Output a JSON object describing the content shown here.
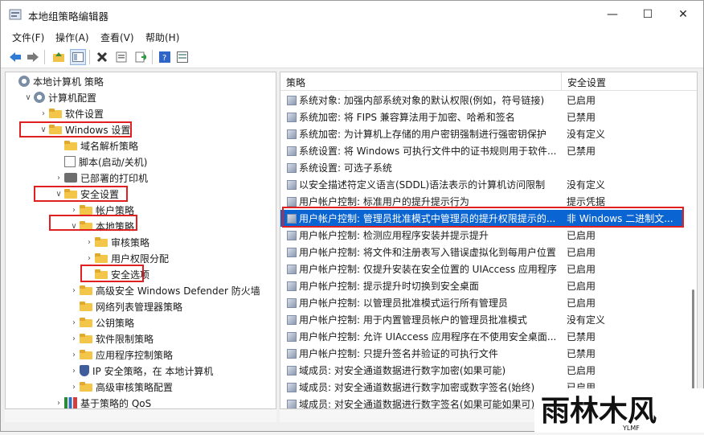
{
  "window": {
    "title": "本地组策略编辑器",
    "minimize": "—",
    "maximize": "☐",
    "close": "✕"
  },
  "menu": [
    "文件(F)",
    "操作(A)",
    "查看(V)",
    "帮助(H)"
  ],
  "toolbar": [
    "back-icon",
    "forward-icon",
    "up-folder-icon",
    "show-tree-icon",
    "delete-icon",
    "properties-icon",
    "export-icon",
    "help-icon",
    "view-icon"
  ],
  "tree": [
    {
      "label": "本地计算机 策略",
      "indent": 0,
      "chev": "",
      "icon": "gear"
    },
    {
      "label": "计算机配置",
      "indent": 1,
      "chev": "∨",
      "icon": "pc"
    },
    {
      "label": "软件设置",
      "indent": 2,
      "chev": "›",
      "icon": "folder"
    },
    {
      "label": "Windows 设置",
      "indent": 2,
      "chev": "∨",
      "icon": "folder"
    },
    {
      "label": "域名解析策略",
      "indent": 3,
      "chev": "",
      "icon": "folder"
    },
    {
      "label": "脚本(启动/关机)",
      "indent": 3,
      "chev": "",
      "icon": "script"
    },
    {
      "label": "已部署的打印机",
      "indent": 3,
      "chev": "›",
      "icon": "printer"
    },
    {
      "label": "安全设置",
      "indent": 3,
      "chev": "∨",
      "icon": "lockfolder"
    },
    {
      "label": "帐户策略",
      "indent": 4,
      "chev": "›",
      "icon": "folder"
    },
    {
      "label": "本地策略",
      "indent": 4,
      "chev": "∨",
      "icon": "folder"
    },
    {
      "label": "审核策略",
      "indent": 5,
      "chev": "›",
      "icon": "folder"
    },
    {
      "label": "用户权限分配",
      "indent": 5,
      "chev": "›",
      "icon": "folder"
    },
    {
      "label": "安全选项",
      "indent": 5,
      "chev": "",
      "icon": "folder"
    },
    {
      "label": "高级安全 Windows Defender 防火墙",
      "indent": 4,
      "chev": "›",
      "icon": "folder"
    },
    {
      "label": "网络列表管理器策略",
      "indent": 4,
      "chev": "",
      "icon": "folder"
    },
    {
      "label": "公钥策略",
      "indent": 4,
      "chev": "›",
      "icon": "folder"
    },
    {
      "label": "软件限制策略",
      "indent": 4,
      "chev": "›",
      "icon": "folder"
    },
    {
      "label": "应用程序控制策略",
      "indent": 4,
      "chev": "›",
      "icon": "folder"
    },
    {
      "label": "IP 安全策略，在 本地计算机",
      "indent": 4,
      "chev": "›",
      "icon": "shield"
    },
    {
      "label": "高级审核策略配置",
      "indent": 4,
      "chev": "›",
      "icon": "folder"
    },
    {
      "label": "基于策略的 QoS",
      "indent": 3,
      "chev": "›",
      "icon": "chart"
    }
  ],
  "list": {
    "headers": [
      "策略",
      "安全设置"
    ],
    "rows": [
      {
        "policy": "系统对象: 加强内部系统对象的默认权限(例如，符号链接)",
        "setting": "已启用"
      },
      {
        "policy": "系统加密: 将 FIPS 兼容算法用于加密、哈希和签名",
        "setting": "已禁用"
      },
      {
        "policy": "系统加密: 为计算机上存储的用户密钥强制进行强密钥保护",
        "setting": "没有定义"
      },
      {
        "policy": "系统设置: 将 Windows 可执行文件中的证书规则用于软件...",
        "setting": "已禁用"
      },
      {
        "policy": "系统设置: 可选子系统",
        "setting": ""
      },
      {
        "policy": "以安全描述符定义语言(SDDL)语法表示的计算机访问限制",
        "setting": "没有定义"
      },
      {
        "policy": "用户帐户控制: 标准用户的提升提示行为",
        "setting": "提示凭据"
      },
      {
        "policy": "用户帐户控制: 管理员批准模式中管理员的提升权限提示的...",
        "setting": "非 Windows 二进制文..."
      },
      {
        "policy": "用户帐户控制: 检测应用程序安装并提示提升",
        "setting": "已启用"
      },
      {
        "policy": "用户帐户控制: 将文件和注册表写入错误虚拟化到每用户位置",
        "setting": "已启用"
      },
      {
        "policy": "用户帐户控制: 仅提升安装在安全位置的 UIAccess 应用程序",
        "setting": "已启用"
      },
      {
        "policy": "用户帐户控制: 提示提升时切换到安全桌面",
        "setting": "已启用"
      },
      {
        "policy": "用户帐户控制: 以管理员批准模式运行所有管理员",
        "setting": "已启用"
      },
      {
        "policy": "用户帐户控制: 用于内置管理员帐户的管理员批准模式",
        "setting": "没有定义"
      },
      {
        "policy": "用户帐户控制: 允许 UIAccess 应用程序在不使用安全桌面...",
        "setting": "已禁用"
      },
      {
        "policy": "用户帐户控制: 只提升签名并验证的可执行文件",
        "setting": "已禁用"
      },
      {
        "policy": "域成员: 对安全通道数据进行数字加密(如果可能)",
        "setting": "已启用"
      },
      {
        "policy": "域成员: 对安全通道数据进行数字加密或数字签名(始终)",
        "setting": "已启用"
      },
      {
        "policy": "域成员: 对安全通道数据进行数字签名(如果可能如果可)",
        "setting": "已启用"
      }
    ]
  },
  "watermark": {
    "text": "雨林木风",
    "sub": "YLMF"
  }
}
